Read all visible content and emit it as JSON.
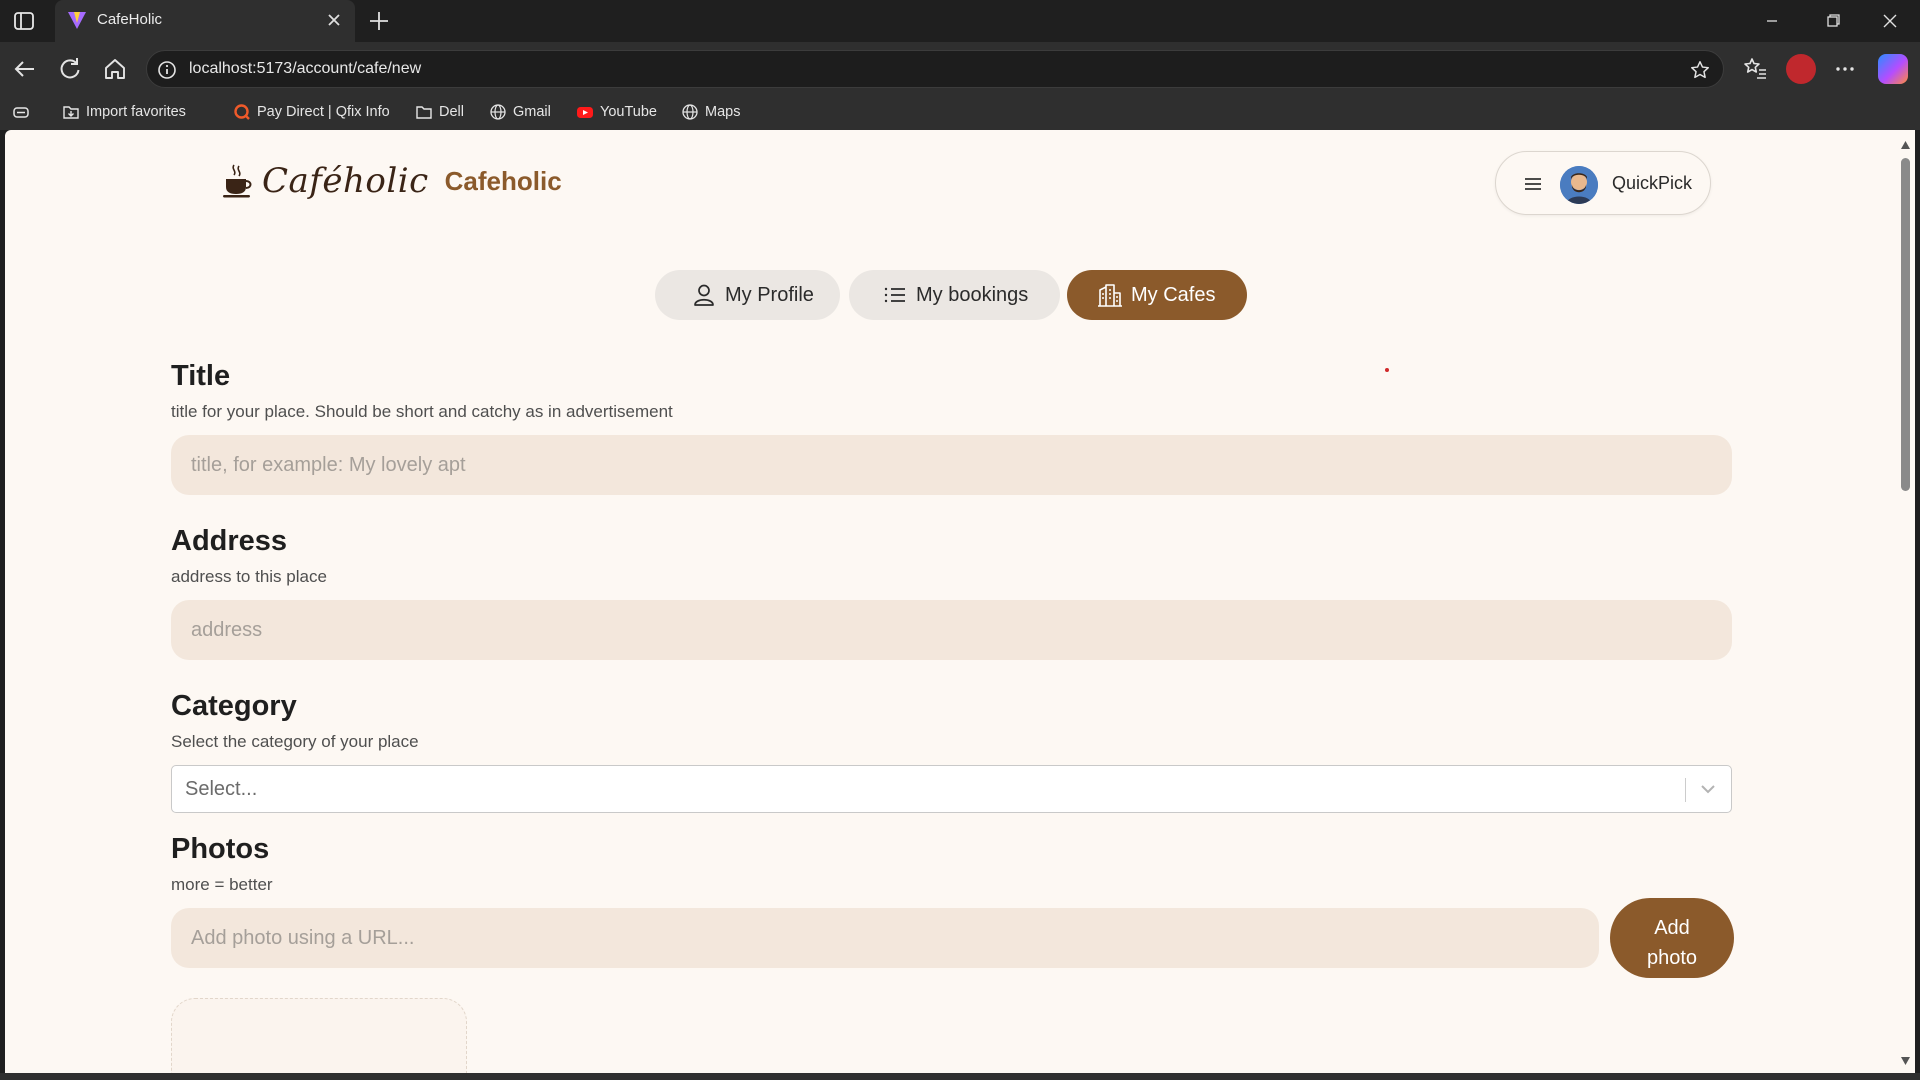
{
  "browser": {
    "tab_title": "CafeHolic",
    "url": "localhost:5173/account/cafe/new",
    "bookmarks": [
      {
        "label": "Import favorites",
        "icon": "import-icon"
      },
      {
        "label": "Pay Direct | Qfix Info",
        "icon": "qfix-icon"
      },
      {
        "label": "Dell",
        "icon": "folder-icon"
      },
      {
        "label": "Gmail",
        "icon": "globe-icon"
      },
      {
        "label": "YouTube",
        "icon": "youtube-icon"
      },
      {
        "label": "Maps",
        "icon": "globe-icon"
      }
    ]
  },
  "header": {
    "logo_script": "Caféholic",
    "brand_name": "Cafeholic",
    "user_name": "QuickPick"
  },
  "account_tabs": [
    {
      "label": "My Profile",
      "icon": "user-icon",
      "active": false
    },
    {
      "label": "My bookings",
      "icon": "list-icon",
      "active": false
    },
    {
      "label": "My Cafes",
      "icon": "building-icon",
      "active": true
    }
  ],
  "form": {
    "title": {
      "heading": "Title",
      "hint": "title for your place. Should be short and catchy as in advertisement",
      "placeholder": "title, for example: My lovely apt"
    },
    "address": {
      "heading": "Address",
      "hint": "address to this place",
      "placeholder": "address"
    },
    "category": {
      "heading": "Category",
      "hint": "Select the category of your place",
      "placeholder": "Select..."
    },
    "photos": {
      "heading": "Photos",
      "hint": "more = better",
      "placeholder": "Add photo using a URL...",
      "add_button_line1": "Add",
      "add_button_line2": "photo"
    }
  },
  "colors": {
    "accent": "#8b5a2b",
    "page_background": "#fdf8f3",
    "input_background": "#f3e7dc",
    "tab_inactive": "#ebe7e3"
  }
}
